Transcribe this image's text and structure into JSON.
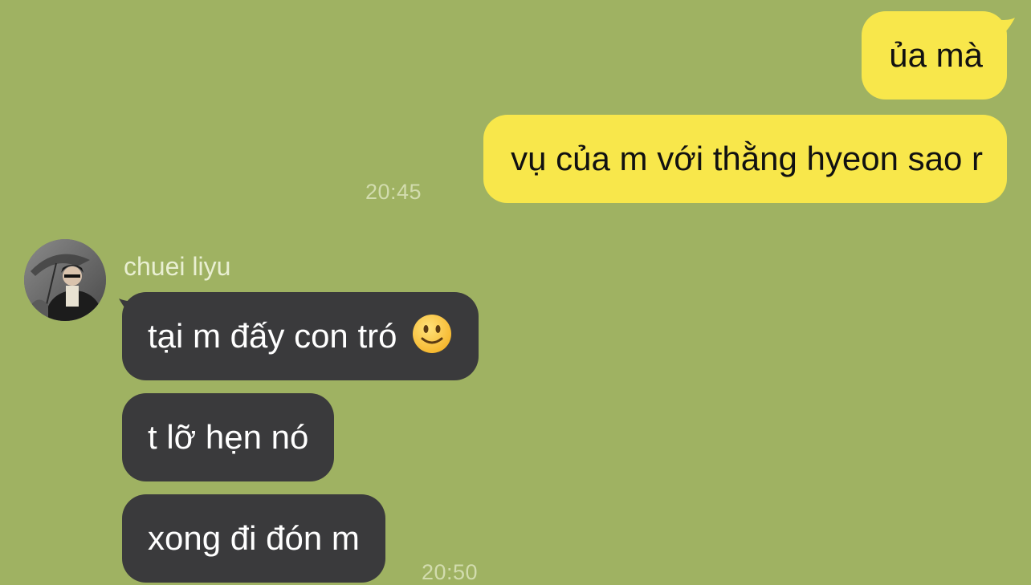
{
  "chat": {
    "colors": {
      "background": "#9fb262",
      "outgoing_bubble": "#f8e74b",
      "incoming_bubble": "#3a3a3c",
      "timestamp": "#d2dcae"
    },
    "outgoing": {
      "messages": [
        {
          "text": "ủa mà"
        },
        {
          "text": "vụ của m với thằng hyeon sao r"
        }
      ],
      "time": "20:45"
    },
    "incoming": {
      "sender": "chuei liyu",
      "avatar_icon": "user-avatar-photo",
      "messages": [
        {
          "text": "tại m đấy con tró",
          "emoji": "slightly-smiling-face-icon"
        },
        {
          "text": "t lỡ hẹn nó"
        },
        {
          "text": "xong đi đón m"
        }
      ],
      "time": "20:50"
    }
  }
}
